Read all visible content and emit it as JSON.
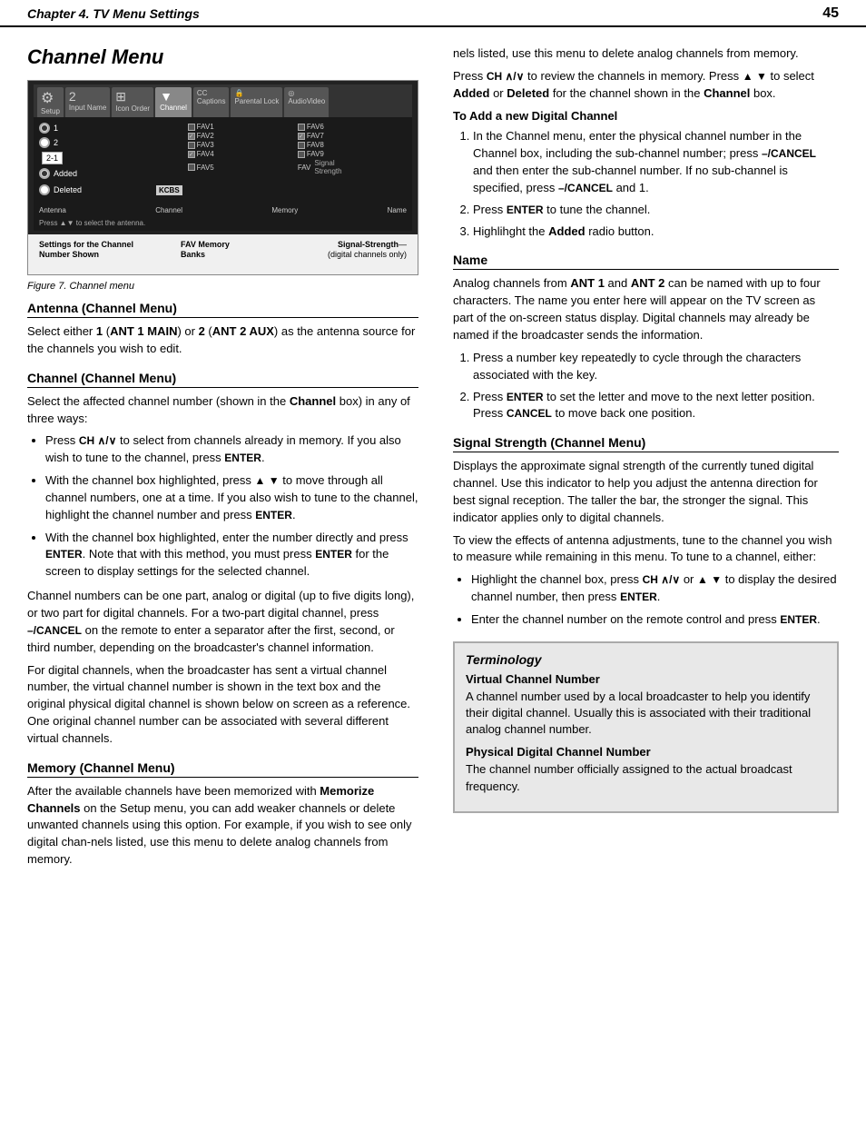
{
  "header": {
    "title": "Chapter 4. TV Menu Settings",
    "page_number": "45"
  },
  "chapter": {
    "title": "Channel Menu"
  },
  "figure": {
    "caption": "Figure 7.  Channel menu",
    "menu_tabs": [
      "Setup",
      "Input Name",
      "Icon Order",
      "Channel",
      "Captions",
      "Parental Lock",
      "AudioVideo"
    ],
    "active_tab": "Channel",
    "antenna_options": [
      "Antenna 1",
      "Antenna 2"
    ],
    "channel_value": "2-1",
    "memory_options": [
      "Added",
      "Deleted"
    ],
    "name_value": "KCBS",
    "fav_items": [
      "FAV1",
      "FAV6",
      "FAV2",
      "FAV7",
      "FAV3",
      "FAV8",
      "FAV4",
      "FAV9",
      "FAV5",
      "FAV"
    ],
    "bottom_labels": {
      "settings": "Settings for the Channel Number Shown",
      "fav": "FAV Memory Banks",
      "signal": "Signal-Strength (digital channels only)"
    },
    "press_line": "Press ▲▼ to select the antenna."
  },
  "antenna_section": {
    "heading": "Antenna (Channel Menu)",
    "text": "Select either ",
    "text2": " (ANT 1 MAIN",
    "text3": ") or ",
    "text4": "2",
    "text5": " (ANT 2 AUX",
    "text6": ") as the antenna source for the channels you wish to edit.",
    "bold1": "1",
    "bold2": "ANT 1 MAIN",
    "bold3": "ANT 2 AUX"
  },
  "channel_section": {
    "heading": "Channel (Channel Menu)",
    "intro": "Select the affected channel number (shown in the",
    "channel_word": "Channel",
    "intro2": "box) in any of three ways:",
    "bullets": [
      "Press CH ∧/∨ to select from channels already in memory.  If you also wish to tune to the channel, press ENTER.",
      "With the channel box highlighted, press ▲ ▼ to move through all channel numbers, one at a time.  If you also wish to tune to the channel, highlight the channel number and press ENTER.",
      "With the channel box highlighted, enter the number directly and press ENTER.  Note that with this method, you must press ENTER for the screen to display settings for the selected channel."
    ],
    "para1": "Channel numbers can be one part, analog or digital (up to five digits long), or two part for digital channels.  For a two-part digital channel, press –/CANCEL on the remote to enter a separator after the first, second, or third number, depending on the broadcaster's channel information.",
    "para2": "For digital channels, when the broadcaster has sent a virtual channel number, the virtual channel number is shown in the text box and the original physical digital channel is shown below on screen as a reference.  One original channel number can be associated with several different virtual channels."
  },
  "memory_section": {
    "heading": "Memory (Channel Menu)",
    "para1": "After the available channels have been memorized with",
    "bold1": "Memorize Channels",
    "para1b": " on the Setup menu, you can add weaker channels or delete unwanted channels using this option.  For example, if you wish to see only digital chan-nels listed, use this menu to delete analog channels from memory.",
    "para2_prefix": "Press CH ∧/∨ to review the channels in memory.  Press ▲ ▼ to select ",
    "bold2": "Added",
    "para2_mid": " or ",
    "bold3": "Deleted",
    "para2_suffix": " for the channel shown in the",
    "bold4": "Channel",
    "para2_end": " box.",
    "digital_heading": "To Add a new Digital Channel",
    "steps": [
      "In the Channel menu, enter the physical channel number in the Channel box, including the sub-channel number; press –/CANCEL and then enter the sub-channel number. If no sub-channel is specified, press –/CANCEL and 1.",
      "Press ENTER to tune the channel.",
      "Highlihght the Added radio button."
    ]
  },
  "name_section": {
    "heading": "Name",
    "para": "Analog channels from ANT 1 and ANT 2 can be named with up to four characters.  The name you enter here will appear on the TV screen as part of the on-screen status display.  Digital channels may already be named if the broadcaster sends the information.",
    "steps": [
      "Press a number key repeatedly to cycle through the characters associated with the key.",
      "Press ENTER to set the letter and move to the next letter position.  Press CANCEL to move back one position."
    ]
  },
  "signal_section": {
    "heading": "Signal Strength (Channel Menu)",
    "para1": "Displays the approximate signal strength of the currently tuned digital channel.  Use this indicator to help you adjust the antenna direction for best signal reception. The taller the bar, the stronger the signal.  This indicator applies only to digital channels.",
    "para2": "To view the effects of antenna adjustments, tune to the channel you wish to measure while remaining in this menu. To tune to a channel, either:",
    "bullets": [
      "Highlight the channel box, press CH ∧/∨ or  ▲ ▼ to display the desired channel number, then press ENTER.",
      "Enter the channel number on the remote control and press ENTER."
    ]
  },
  "terminology": {
    "title": "Terminology",
    "term1_heading": "Virtual Channel Number",
    "term1_body": "A channel number used by a local broadcaster to help you identify their digital channel.  Usually this is associated with their traditional analog channel number.",
    "term2_heading": "Physical Digital Channel Number",
    "term2_body": "The channel number officially assigned to the actual broadcast frequency."
  }
}
